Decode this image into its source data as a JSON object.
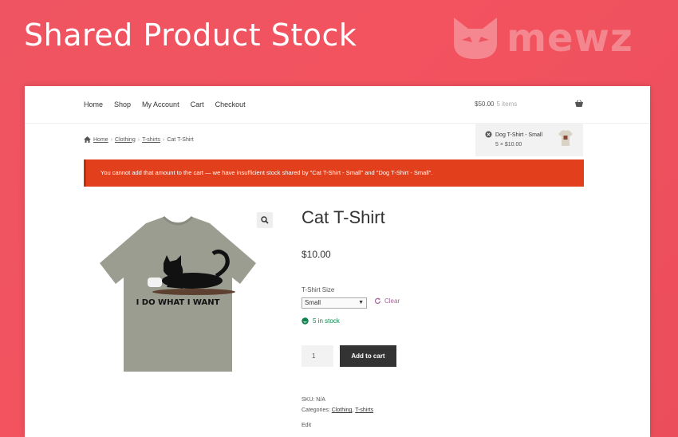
{
  "banner": {
    "title": "Shared Product Stock",
    "brand": "mewz"
  },
  "nav": {
    "items": [
      "Home",
      "Shop",
      "My Account",
      "Cart",
      "Checkout"
    ]
  },
  "cart_header": {
    "total": "$50.00",
    "items": "5 items"
  },
  "mini_cart": {
    "name": "Dog T-Shirt - Small",
    "qty": "5 × $10.00"
  },
  "breadcrumb": {
    "home": "Home",
    "cat1": "Clothing",
    "cat2": "T-shirts",
    "current": "Cat T-Shirt"
  },
  "error": {
    "message": "You cannot add that amount to the cart — we have insufficient stock shared by \"Cat T-Shirt - Small\" and \"Dog T-Shirt - Small\"."
  },
  "product": {
    "title": "Cat T-Shirt",
    "price": "$10.00",
    "shirt_text": "I DO WHAT I WANT",
    "size_label": "T-Shirt Size",
    "size_selected": "Small",
    "clear_label": "Clear",
    "stock": "5 in stock",
    "quantity": "1",
    "add_to_cart": "Add to cart",
    "sku_label": "SKU:",
    "sku": "N/A",
    "categories_label": "Categories:",
    "category1": "Clothing",
    "category2": "T-shirts",
    "edit": "Edit"
  },
  "colors": {
    "background": "#ee5461",
    "error": "#e2401c",
    "stock": "#0f834d",
    "link": "#a46497",
    "button": "#333333"
  }
}
